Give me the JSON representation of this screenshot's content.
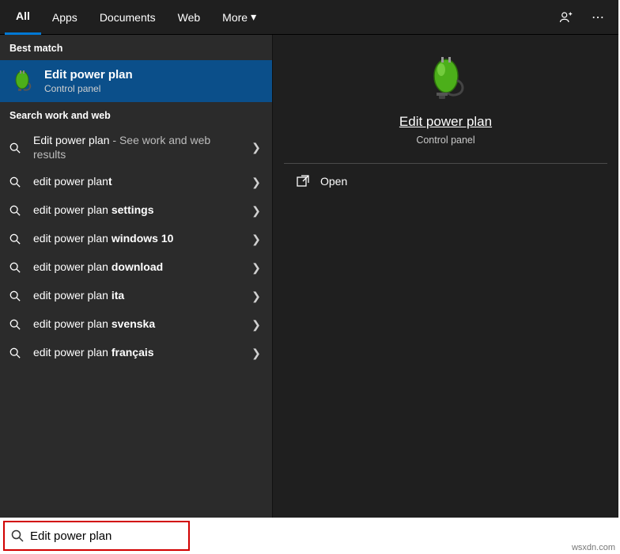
{
  "tabs": {
    "all": "All",
    "apps": "Apps",
    "documents": "Documents",
    "web": "Web",
    "more": "More"
  },
  "sections": {
    "best": "Best match",
    "web": "Search work and web"
  },
  "best": {
    "title": "Edit power plan",
    "sub": "Control panel"
  },
  "items": [
    {
      "pre": "Edit power plan",
      "suf": " - See work and web results"
    },
    {
      "pre": "edit power plan",
      "suf": "t"
    },
    {
      "pre": "edit power plan ",
      "suf": "settings"
    },
    {
      "pre": "edit power plan ",
      "suf": "windows 10"
    },
    {
      "pre": "edit power plan ",
      "suf": "download"
    },
    {
      "pre": "edit power plan ",
      "suf": "ita"
    },
    {
      "pre": "edit power plan ",
      "suf": "svenska"
    },
    {
      "pre": "edit power plan ",
      "suf": "français"
    }
  ],
  "preview": {
    "title": "Edit power plan",
    "sub": "Control panel",
    "open": "Open"
  },
  "search": {
    "value": "Edit power plan"
  },
  "watermark": "wsxdn.com"
}
